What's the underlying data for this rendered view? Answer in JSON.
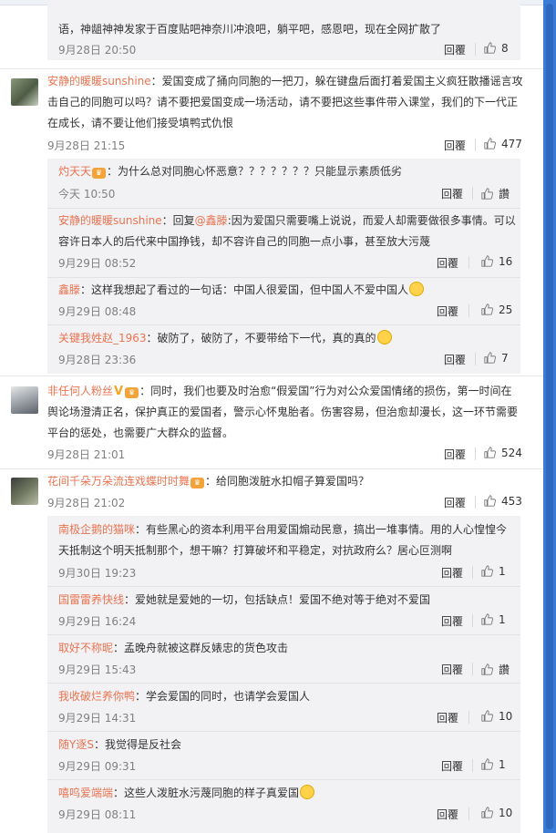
{
  "top_comment_tail": {
    "text": "语，神龃神神发家于百度贴吧神奈川冲浪吧，躺平吧，感恩吧，现在全网扩散了",
    "time": "9月28日 20:50",
    "reply": "回覆",
    "likes": "8"
  },
  "comments": [
    {
      "user": "安静的暖暖sunshine",
      "line1": "：爱国变成了捅向同胞的一把刀，躲在键盘后面打着爱国主义疯狂散播谣言攻",
      "line2": "击自己的同胞可以吗？请不要把爱国变成一场活动，请不要把这些事件带入课堂，我们的下一代正",
      "line3": "在成长，请不要让他们接受填鸭式仇恨",
      "time": "9月28日 21:15",
      "reply": "回覆",
      "likes": "477",
      "replies": [
        {
          "user": "灼天天",
          "badge": "♛",
          "text": "：为什么总对同胞心怀恶意？？？？？？？只能显示素质低劣",
          "time": "今天 10:50",
          "reply": "回覆",
          "likes": "讚"
        },
        {
          "user": "安静的暖暖sunshine",
          "text_pre": "：回复",
          "mention": "@鑫滕",
          "text": ":因为爱国只需要嘴上说说，而爱人却需要做很多事情。可以",
          "line2": "容许日本人的后代来中国挣钱，却不容许自己的同胞一点小事，甚至放大污蔑",
          "time": "9月29日 08:52",
          "reply": "回覆",
          "likes": "16"
        },
        {
          "user": "鑫滕",
          "text": "：这样我想起了看过的一句话：中国人很爱国，但中国人不爱中国人",
          "time": "9月29日 08:48",
          "reply": "回覆",
          "likes": "25"
        },
        {
          "user": "关键我姓赵_1963",
          "text": "：破防了，破防了，不要带给下一代，真的真的",
          "time": "9月28日 23:36",
          "reply": "回覆",
          "likes": "7"
        }
      ]
    },
    {
      "user": "非任何人粉丝",
      "badge": "♛",
      "line1": "：同时，我们也要及时治愈“假爱国”行为对公众爱国情绪的损伤，第一时间在",
      "line2": "舆论场澄清正名，保护真正的爱国者，警示心怀鬼胎者。伤害容易，但治愈却漫长，这一环节需要",
      "line3": "平台的惩处，也需要广大群众的监督。",
      "time": "9月28日 21:01",
      "reply": "回覆",
      "likes": "524"
    },
    {
      "user": "花间千朵万朵流连戏蝶时时舞",
      "badge": "♛",
      "line1": "：给同胞泼脏水扣帽子算爱国吗？",
      "time": "9月28日 21:02",
      "reply": "回覆",
      "likes": "453",
      "replies": [
        {
          "user": "南极企鹅的猫咪",
          "text": "：有些黑心的资本利用平台用爱国煽动民意，搞出一堆事情。用的人心惶惶今",
          "line2": "天抵制这个明天抵制那个，想干嘛？打算破坏和平稳定，对抗政府么？居心叵测啊",
          "time": "9月30日 19:23",
          "reply": "回覆",
          "likes": "1"
        },
        {
          "user": "国雷雷养快线",
          "text": "：爱她就是爱她的一切，包括缺点！爱国不绝对等于绝对不爱国",
          "time": "9月29日 16:24",
          "reply": "回覆",
          "likes": "1"
        },
        {
          "user": "取好不称昵",
          "text": "：孟晚舟就被这群反婊忠的货色攻击",
          "time": "9月29日 15:43",
          "reply": "回覆",
          "likes": "讚"
        },
        {
          "user": "我收破烂养你鸭",
          "text": "：学会爱国的同时，也请学会爱国人",
          "time": "9月29日 14:31",
          "reply": "回覆",
          "likes": "10"
        },
        {
          "user": "随Y逐S",
          "text": "：我觉得是反社会",
          "time": "9月29日 09:31",
          "reply": "回覆",
          "likes": "1"
        },
        {
          "user": "嘻呜爱端端",
          "text": "：这些人泼脏水污蔑同胞的样子真爱国",
          "time": "9月29日 08:11",
          "reply": "回覆",
          "likes": "10"
        }
      ]
    }
  ]
}
